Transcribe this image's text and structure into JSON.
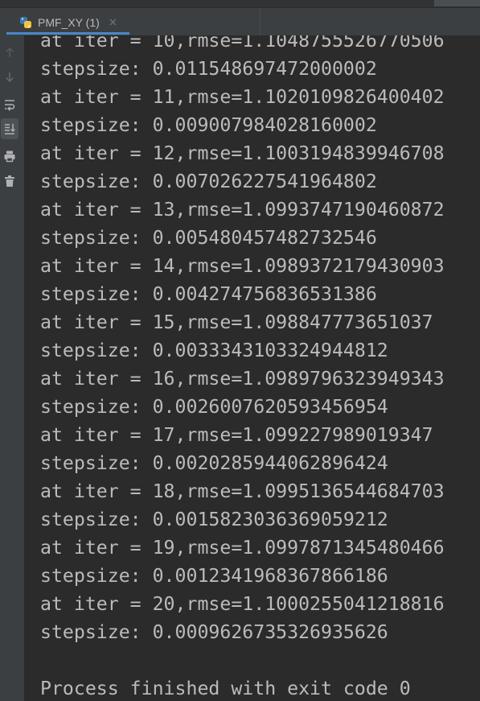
{
  "run_panel": {
    "tab": {
      "title": "PMF_XY (1)",
      "icon": "python-icon",
      "close_icon": "close-icon",
      "selected": true
    }
  },
  "toolbar": {
    "icons": [
      {
        "name": "up-arrow-icon",
        "enabled": false
      },
      {
        "name": "down-arrow-icon",
        "enabled": false
      },
      {
        "name": "soft-wrap-icon",
        "enabled": true
      },
      {
        "name": "scroll-to-end-icon",
        "enabled": true,
        "active": true
      },
      {
        "name": "print-icon",
        "enabled": true
      },
      {
        "name": "trash-icon",
        "enabled": true
      }
    ]
  },
  "console": {
    "output_lines": [
      "at iter = 10,rmse=1.1048755526770506",
      "stepsize: 0.011548697472000002",
      "at iter = 11,rmse=1.1020109826400402",
      "stepsize: 0.009007984028160002",
      "at iter = 12,rmse=1.1003194839946708",
      "stepsize: 0.007026227541964802",
      "at iter = 13,rmse=1.0993747190460872",
      "stepsize: 0.005480457482732546",
      "at iter = 14,rmse=1.0989372179430903",
      "stepsize: 0.004274756836531386",
      "at iter = 15,rmse=1.098847773651037",
      "stepsize: 0.0033343103324944812",
      "at iter = 16,rmse=1.0989796323949343",
      "stepsize: 0.0026007620593456954",
      "at iter = 17,rmse=1.099227989019347",
      "stepsize: 0.0020285944062896424",
      "at iter = 18,rmse=1.0995136544684703",
      "stepsize: 0.0015823036369059212",
      "at iter = 19,rmse=1.0997871345480466",
      "stepsize: 0.0012341968367866186",
      "at iter = 20,rmse=1.1000255041218816",
      "stepsize: 0.0009626735326935626"
    ],
    "exit_message": "Process finished with exit code 0"
  },
  "colors": {
    "console_background": "#2b2b2b",
    "panel_background": "#3c3f41",
    "console_text": "#bbbbbb",
    "selected_tab_indicator": "#4a88c7"
  }
}
